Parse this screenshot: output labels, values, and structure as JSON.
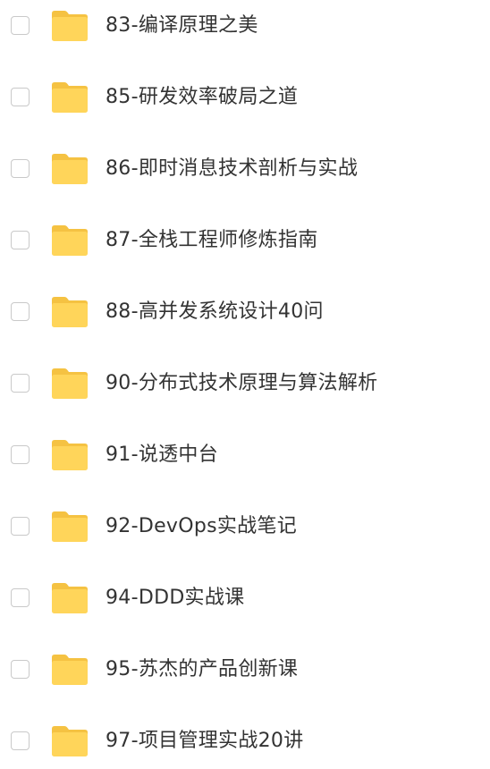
{
  "files": [
    {
      "name": "83-编译原理之美",
      "icon": "folder-icon"
    },
    {
      "name": "85-研发效率破局之道",
      "icon": "folder-icon"
    },
    {
      "name": "86-即时消息技术剖析与实战",
      "icon": "folder-icon"
    },
    {
      "name": "87-全栈工程师修炼指南",
      "icon": "folder-icon"
    },
    {
      "name": "88-高并发系统设计40问",
      "icon": "folder-icon"
    },
    {
      "name": "90-分布式技术原理与算法解析",
      "icon": "folder-icon"
    },
    {
      "name": "91-说透中台",
      "icon": "folder-icon"
    },
    {
      "name": "92-DevOps实战笔记",
      "icon": "folder-icon"
    },
    {
      "name": "94-DDD实战课",
      "icon": "folder-icon"
    },
    {
      "name": "95-苏杰的产品创新课",
      "icon": "folder-icon"
    },
    {
      "name": "97-项目管理实战20讲",
      "icon": "folder-icon"
    }
  ],
  "colors": {
    "folder_body": "#FFD55A",
    "folder_back": "#F5C242",
    "text": "#333333",
    "checkbox_border": "#C9C9C9"
  }
}
